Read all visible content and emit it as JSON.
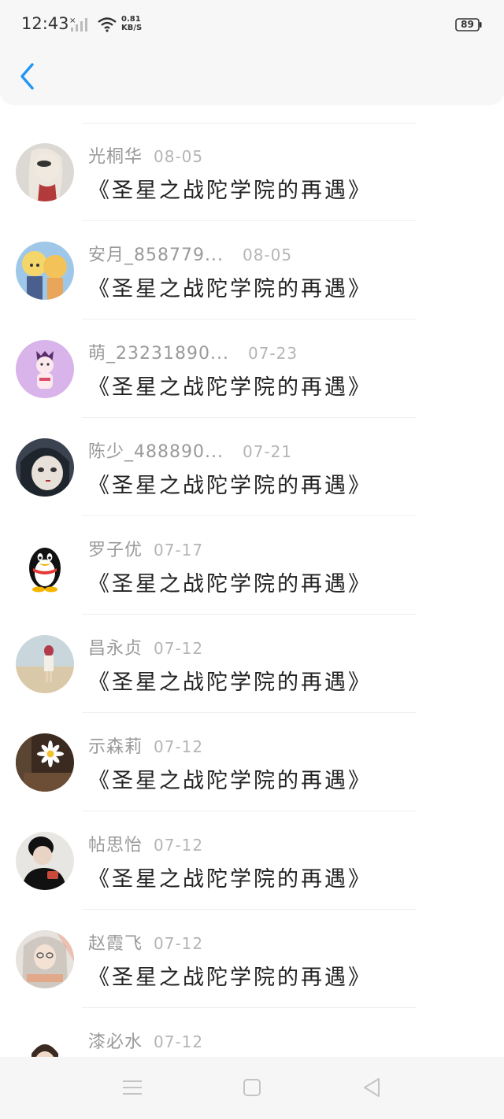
{
  "status_bar": {
    "time": "12:43",
    "net_speed_value": "0.81",
    "net_speed_unit": "KB/S",
    "battery": "89"
  },
  "header": {
    "back_icon": "chevron-left-icon",
    "accent_color": "#2196F3"
  },
  "comments": [
    {
      "name": "光桐华",
      "date": "08-05",
      "message": "《圣星之战陀学院的再遇》",
      "avatar": "woman-photo"
    },
    {
      "name": "安月_858779...",
      "date": "08-05",
      "message": "《圣星之战陀学院的再遇》",
      "avatar": "anime-girls"
    },
    {
      "name": "萌_23231890...",
      "date": "07-23",
      "message": "《圣星之战陀学院的再遇》",
      "avatar": "purple-cartoon"
    },
    {
      "name": "陈少_488890...",
      "date": "07-21",
      "message": "《圣星之战陀学院的再遇》",
      "avatar": "anime-face"
    },
    {
      "name": "罗子优",
      "date": "07-17",
      "message": "《圣星之战陀学院的再遇》",
      "avatar": "penguin"
    },
    {
      "name": "昌永贞",
      "date": "07-12",
      "message": "《圣星之战陀学院的再遇》",
      "avatar": "beach-photo"
    },
    {
      "name": "示森莉",
      "date": "07-12",
      "message": "《圣星之战陀学院的再遇》",
      "avatar": "daisy-photo"
    },
    {
      "name": "帖思怡",
      "date": "07-12",
      "message": "《圣星之战陀学院的再遇》",
      "avatar": "person-dark"
    },
    {
      "name": "赵霞飞",
      "date": "07-12",
      "message": "《圣星之战陀学院的再遇》",
      "avatar": "girl-photo"
    },
    {
      "name": "漆必水",
      "date": "07-12",
      "message": "",
      "avatar": "man-glasses"
    }
  ],
  "nav_bar": {
    "menu_icon": "menu-icon",
    "home_icon": "home-square-icon",
    "back_icon": "back-triangle-icon"
  }
}
